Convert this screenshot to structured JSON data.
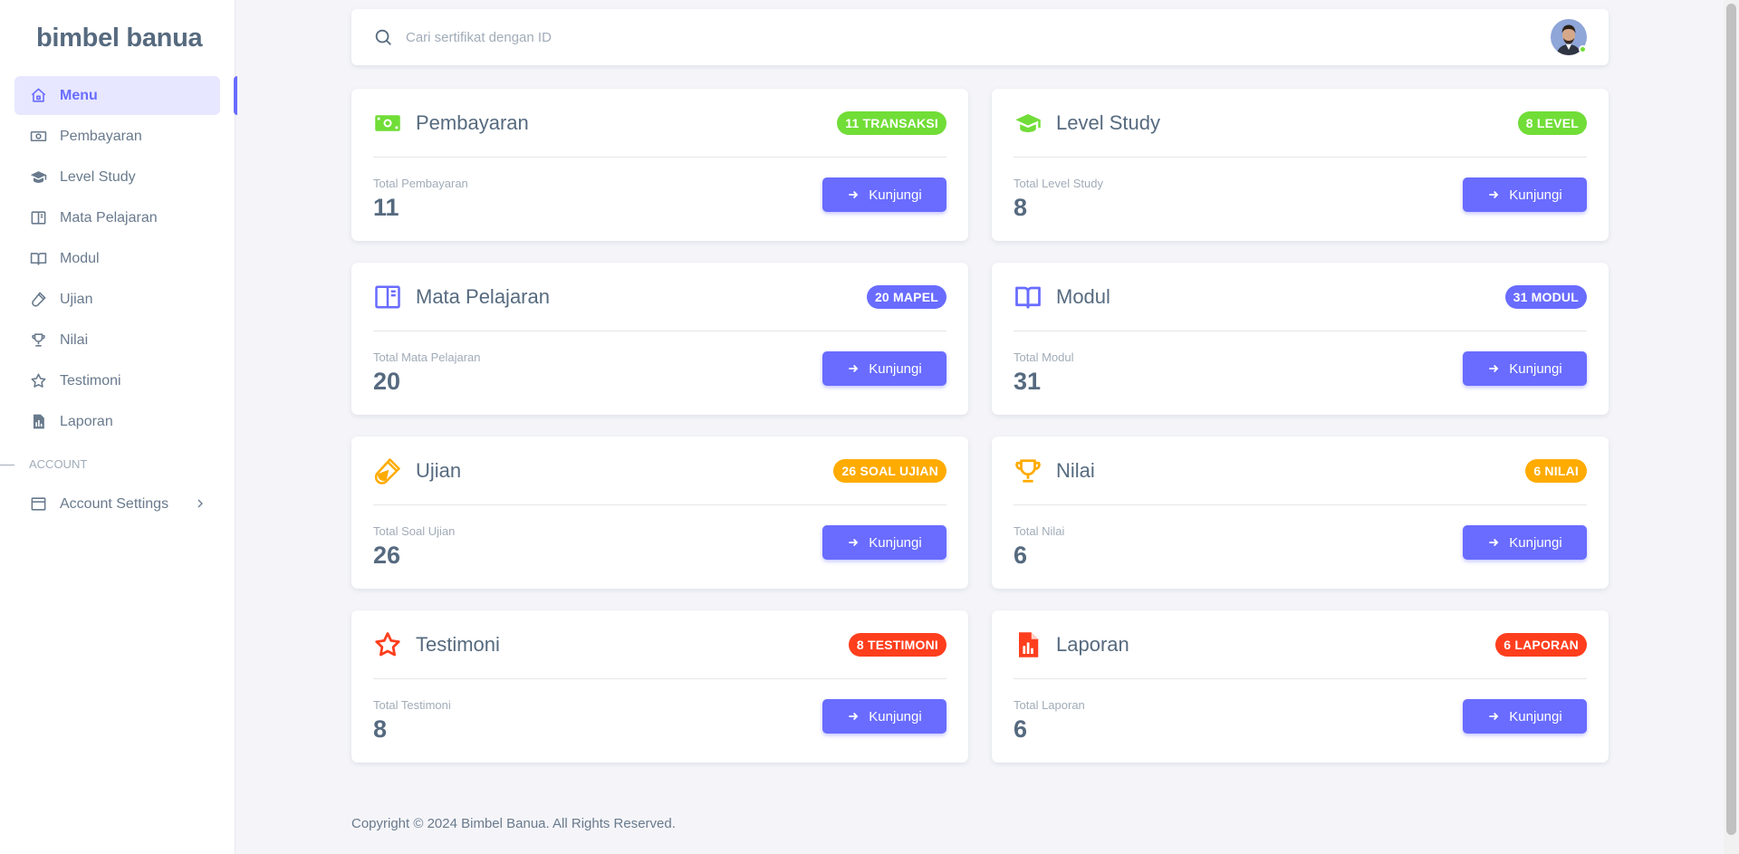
{
  "brand": "bimbel banua",
  "sidebar": {
    "items": [
      {
        "label": "Menu",
        "icon": "home-icon"
      },
      {
        "label": "Pembayaran",
        "icon": "money-icon"
      },
      {
        "label": "Level Study",
        "icon": "graduation-cap-icon"
      },
      {
        "label": "Mata Pelajaran",
        "icon": "book-layout-icon"
      },
      {
        "label": "Modul",
        "icon": "open-book-icon"
      },
      {
        "label": "Ujian",
        "icon": "test-tube-icon"
      },
      {
        "label": "Nilai",
        "icon": "trophy-icon"
      },
      {
        "label": "Testimoni",
        "icon": "star-icon"
      },
      {
        "label": "Laporan",
        "icon": "report-icon"
      }
    ],
    "section_account": "Account",
    "account_settings": "Account Settings"
  },
  "search": {
    "placeholder": "Cari sertifikat dengan ID"
  },
  "colors": {
    "primary": "#696cff",
    "success": "#71dd37",
    "warning": "#ffab00",
    "danger": "#ff3e1d"
  },
  "cards": [
    {
      "title": "Pembayaran",
      "badge": "11 Transaksi",
      "label": "Total Pembayaran",
      "value": "11",
      "color": "#71dd37",
      "icon": "money-icon"
    },
    {
      "title": "Level Study",
      "badge": "8 Level",
      "label": "Total Level Study",
      "value": "8",
      "color": "#71dd37",
      "icon": "graduation-cap-icon"
    },
    {
      "title": "Mata Pelajaran",
      "badge": "20 Mapel",
      "label": "Total Mata Pelajaran",
      "value": "20",
      "color": "#696cff",
      "icon": "book-layout-icon"
    },
    {
      "title": "Modul",
      "badge": "31 Modul",
      "label": "Total Modul",
      "value": "31",
      "color": "#696cff",
      "icon": "open-book-icon"
    },
    {
      "title": "Ujian",
      "badge": "26 Soal Ujian",
      "label": "Total Soal Ujian",
      "value": "26",
      "color": "#ffab00",
      "icon": "test-tube-icon"
    },
    {
      "title": "Nilai",
      "badge": "6 Nilai",
      "label": "Total Nilai",
      "value": "6",
      "color": "#ffab00",
      "icon": "trophy-icon"
    },
    {
      "title": "Testimoni",
      "badge": "8 Testimoni",
      "label": "Total Testimoni",
      "value": "8",
      "color": "#ff3e1d",
      "icon": "star-icon"
    },
    {
      "title": "Laporan",
      "badge": "6 Laporan",
      "label": "Total Laporan",
      "value": "6",
      "color": "#ff3e1d",
      "icon": "report-icon"
    }
  ],
  "button_label": "Kunjungi",
  "footer": "Copyright © 2024 Bimbel Banua. All Rights Reserved."
}
